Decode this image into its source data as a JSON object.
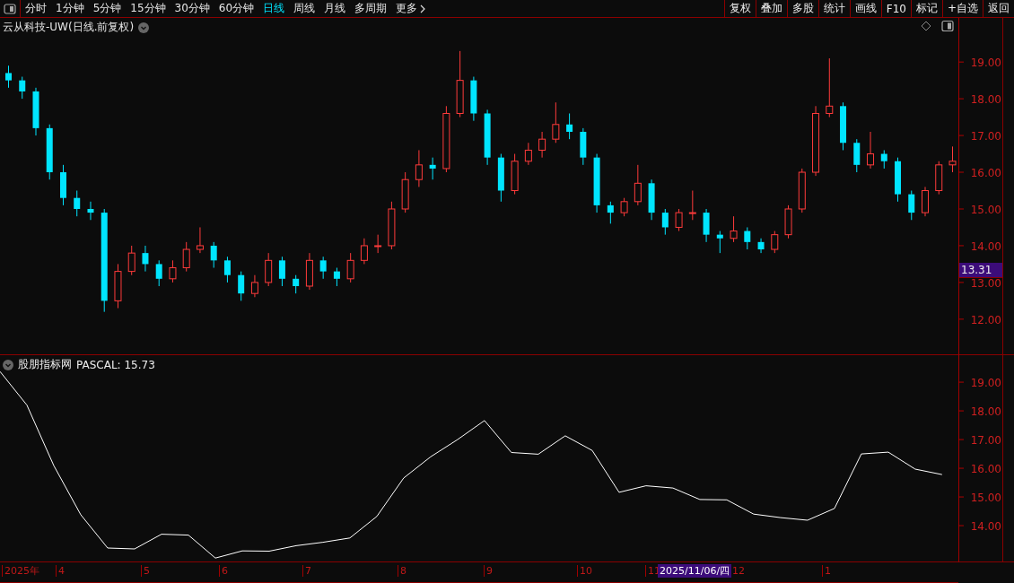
{
  "toolbar": {
    "periods": [
      {
        "label": "分时",
        "selected": false
      },
      {
        "label": "1分钟",
        "selected": false
      },
      {
        "label": "5分钟",
        "selected": false
      },
      {
        "label": "15分钟",
        "selected": false
      },
      {
        "label": "30分钟",
        "selected": false
      },
      {
        "label": "60分钟",
        "selected": false
      },
      {
        "label": "日线",
        "selected": true
      },
      {
        "label": "周线",
        "selected": false
      },
      {
        "label": "月线",
        "selected": false
      },
      {
        "label": "多周期",
        "selected": false
      }
    ],
    "more": "更多",
    "actions": [
      "复权",
      "叠加",
      "多股",
      "统计",
      "画线",
      "F10",
      "标记",
      "+自选",
      "返回"
    ]
  },
  "price_chart": {
    "title": "云从科技-UW(日线.前复权)",
    "current_price": "13.31",
    "chart_data": {
      "type": "candlestick",
      "categories": [
        null,
        null,
        null,
        null,
        null,
        null,
        null,
        null,
        null,
        null,
        null,
        null,
        null,
        null,
        null,
        null,
        null,
        null,
        null,
        null,
        null,
        null,
        null,
        null,
        null,
        null,
        null,
        null,
        null,
        null,
        null,
        null,
        null,
        null,
        null,
        null,
        null,
        null,
        null,
        null,
        null,
        null,
        null,
        null,
        null,
        null,
        null,
        null,
        null,
        null,
        null,
        null,
        null,
        null,
        null,
        null,
        null,
        null,
        null,
        null,
        null,
        null,
        null,
        null,
        null,
        null,
        null,
        null,
        null,
        null
      ],
      "ohlc": [
        [
          18.7,
          18.9,
          18.3,
          18.5
        ],
        [
          18.5,
          18.6,
          18.0,
          18.2
        ],
        [
          18.2,
          18.3,
          17.0,
          17.2
        ],
        [
          17.2,
          17.3,
          15.8,
          16.0
        ],
        [
          16.0,
          16.2,
          15.1,
          15.3
        ],
        [
          15.3,
          15.5,
          14.8,
          15.0
        ],
        [
          15.0,
          15.2,
          14.7,
          14.9
        ],
        [
          14.9,
          15.0,
          12.2,
          12.5
        ],
        [
          12.5,
          13.5,
          12.3,
          13.3
        ],
        [
          13.3,
          14.0,
          13.2,
          13.8
        ],
        [
          13.8,
          14.0,
          13.3,
          13.5
        ],
        [
          13.5,
          13.6,
          12.9,
          13.1
        ],
        [
          13.1,
          13.6,
          13.0,
          13.4
        ],
        [
          13.4,
          14.1,
          13.3,
          13.9
        ],
        [
          13.9,
          14.5,
          13.8,
          14.0
        ],
        [
          14.0,
          14.1,
          13.4,
          13.6
        ],
        [
          13.6,
          13.7,
          13.0,
          13.2
        ],
        [
          13.2,
          13.3,
          12.5,
          12.7
        ],
        [
          12.7,
          13.2,
          12.6,
          13.0
        ],
        [
          13.0,
          13.8,
          12.9,
          13.6
        ],
        [
          13.6,
          13.7,
          12.9,
          13.1
        ],
        [
          13.1,
          13.2,
          12.7,
          12.9
        ],
        [
          12.9,
          13.8,
          12.8,
          13.6
        ],
        [
          13.6,
          13.7,
          13.1,
          13.3
        ],
        [
          13.3,
          13.4,
          12.9,
          13.1
        ],
        [
          13.1,
          13.8,
          13.0,
          13.6
        ],
        [
          13.6,
          14.2,
          13.5,
          14.0
        ],
        [
          14.0,
          14.3,
          13.8,
          14.0
        ],
        [
          14.0,
          15.2,
          13.9,
          15.0
        ],
        [
          15.0,
          16.0,
          14.9,
          15.8
        ],
        [
          15.8,
          16.6,
          15.6,
          16.2
        ],
        [
          16.2,
          16.4,
          15.8,
          16.1
        ],
        [
          16.1,
          17.8,
          16.0,
          17.6
        ],
        [
          17.6,
          19.3,
          17.5,
          18.5
        ],
        [
          18.5,
          18.6,
          17.4,
          17.6
        ],
        [
          17.6,
          17.7,
          16.2,
          16.4
        ],
        [
          16.4,
          16.5,
          15.2,
          15.5
        ],
        [
          15.5,
          16.5,
          15.4,
          16.3
        ],
        [
          16.3,
          16.8,
          16.2,
          16.6
        ],
        [
          16.6,
          17.1,
          16.4,
          16.9
        ],
        [
          16.9,
          17.9,
          16.8,
          17.3
        ],
        [
          17.3,
          17.6,
          16.9,
          17.1
        ],
        [
          17.1,
          17.2,
          16.2,
          16.4
        ],
        [
          16.4,
          16.5,
          14.9,
          15.1
        ],
        [
          15.1,
          15.2,
          14.6,
          14.9
        ],
        [
          14.9,
          15.3,
          14.8,
          15.2
        ],
        [
          15.2,
          16.2,
          15.1,
          15.7
        ],
        [
          15.7,
          15.8,
          14.7,
          14.9
        ],
        [
          14.9,
          15.0,
          14.3,
          14.5
        ],
        [
          14.5,
          15.0,
          14.4,
          14.9
        ],
        [
          14.9,
          15.5,
          14.7,
          14.9
        ],
        [
          14.9,
          15.0,
          14.1,
          14.3
        ],
        [
          14.3,
          14.4,
          13.8,
          14.2
        ],
        [
          14.2,
          14.8,
          14.1,
          14.4
        ],
        [
          14.4,
          14.5,
          13.9,
          14.1
        ],
        [
          14.1,
          14.2,
          13.8,
          13.9
        ],
        [
          13.9,
          14.4,
          13.8,
          14.3
        ],
        [
          14.3,
          15.1,
          14.2,
          15.0
        ],
        [
          15.0,
          16.1,
          14.9,
          16.0
        ],
        [
          16.0,
          17.8,
          15.9,
          17.6
        ],
        [
          17.6,
          19.1,
          17.5,
          17.8
        ],
        [
          17.8,
          17.9,
          16.6,
          16.8
        ],
        [
          16.8,
          16.9,
          16.0,
          16.2
        ],
        [
          16.2,
          17.1,
          16.1,
          16.5
        ],
        [
          16.5,
          16.6,
          16.1,
          16.3
        ],
        [
          16.3,
          16.4,
          15.2,
          15.4
        ],
        [
          15.4,
          15.5,
          14.7,
          14.9
        ],
        [
          14.9,
          15.6,
          14.8,
          15.5
        ],
        [
          15.5,
          16.3,
          15.4,
          16.2
        ],
        [
          16.2,
          16.7,
          16.0,
          16.3
        ]
      ],
      "ylim": [
        11.02,
        20.2
      ],
      "yticks": [
        {
          "value": 19,
          "label": "19.00"
        },
        {
          "value": 18,
          "label": "18.00"
        },
        {
          "value": 17,
          "label": "17.00"
        },
        {
          "value": 16,
          "label": "16.00"
        },
        {
          "value": 15,
          "label": "15.00"
        },
        {
          "value": 14,
          "label": "14.00"
        },
        {
          "value": 13,
          "label": "13.00"
        },
        {
          "value": 12,
          "label": "12.00"
        }
      ]
    }
  },
  "indicator": {
    "name": "股朋指标网",
    "reading": "PASCAL: 15.73",
    "chart_data": {
      "type": "line",
      "categories": [
        null,
        null,
        null,
        null,
        null,
        null,
        null,
        null,
        null,
        null,
        null,
        null,
        null,
        null,
        null,
        null,
        null,
        null,
        null,
        null,
        null,
        null,
        null,
        null,
        null,
        null,
        null,
        null,
        null,
        null,
        null,
        null,
        null,
        null,
        null,
        null
      ],
      "series": [
        {
          "color": "#ffffff",
          "values": [
            19.37,
            18.2,
            16.09,
            14.38,
            13.22,
            13.19,
            13.7,
            13.67,
            12.87,
            13.12,
            13.11,
            13.3,
            13.42,
            13.57,
            14.32,
            15.66,
            16.4,
            17.0,
            17.66,
            16.55,
            16.49,
            17.13,
            16.62,
            15.16,
            15.39,
            15.31,
            14.91,
            14.9,
            14.4,
            14.28,
            14.19,
            14.6,
            16.5,
            16.56,
            15.97,
            15.78
          ]
        }
      ],
      "ylim": [
        12.72,
        19.94
      ],
      "yticks": [
        {
          "value": 19,
          "label": "19.00"
        },
        {
          "value": 18,
          "label": "18.00"
        },
        {
          "value": 17,
          "label": "17.00"
        },
        {
          "value": 16,
          "label": "16.00"
        },
        {
          "value": 15,
          "label": "15.00"
        },
        {
          "value": 14,
          "label": "14.00"
        }
      ]
    }
  },
  "time_axis": {
    "labels": [
      "2025年",
      "4",
      "5",
      "6",
      "7",
      "8",
      "9",
      "10",
      "11",
      "12",
      "1"
    ],
    "cursor": "2025/11/06/四"
  }
}
